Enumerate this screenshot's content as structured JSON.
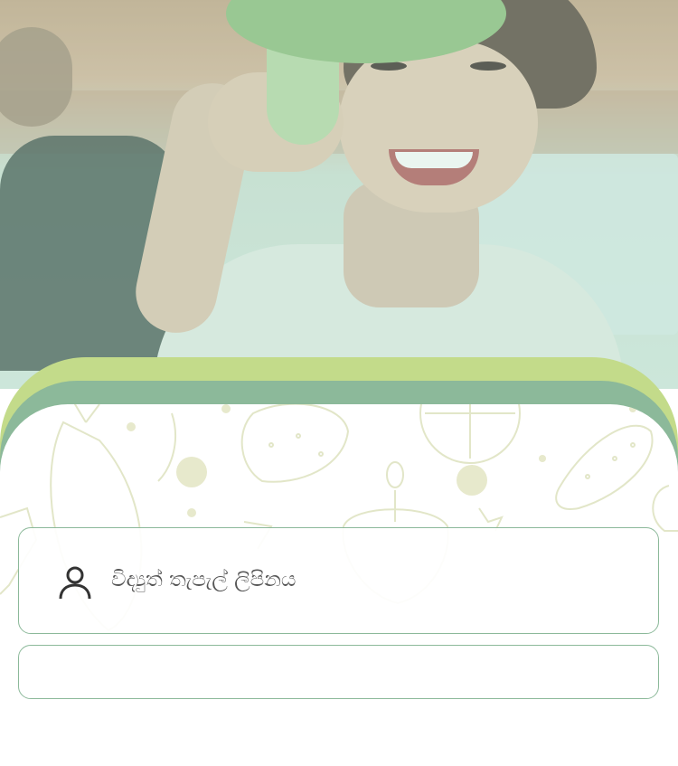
{
  "form": {
    "email_field": {
      "placeholder": "විද්‍යුත් තැපැල් ලිපිනය",
      "icon": "user-icon"
    }
  },
  "colors": {
    "lime_layer": "#c3db8a",
    "sage_layer": "#8cb99a",
    "field_border": "#8cb99a"
  }
}
